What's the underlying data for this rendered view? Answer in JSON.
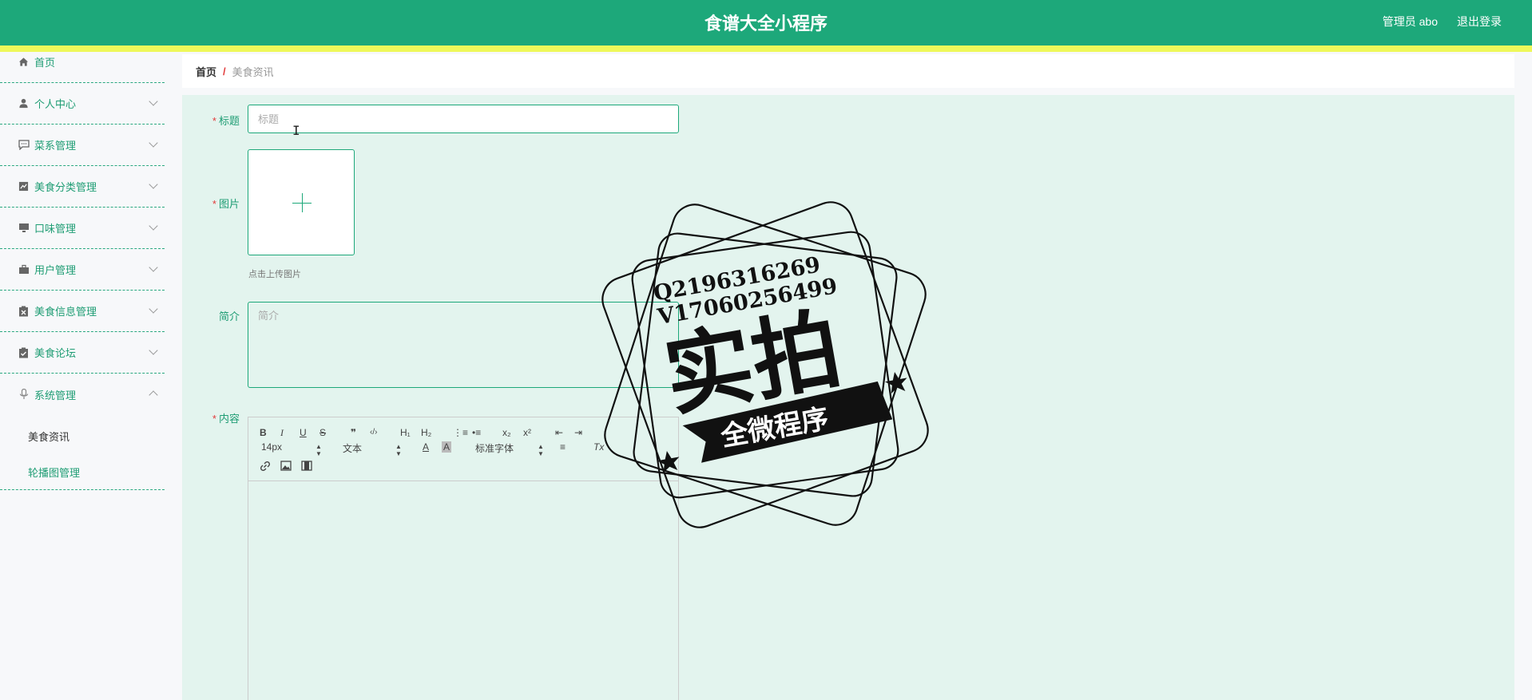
{
  "header": {
    "app_title": "食谱大全小程序",
    "user_label": "管理员 abo",
    "logout_label": "退出登录"
  },
  "sidebar": {
    "items": [
      {
        "label": "首页",
        "icon": "home-icon"
      },
      {
        "label": "个人中心",
        "icon": "user-icon"
      },
      {
        "label": "菜系管理",
        "icon": "chat-icon"
      },
      {
        "label": "美食分类管理",
        "icon": "chart-icon"
      },
      {
        "label": "口味管理",
        "icon": "monitor-icon"
      },
      {
        "label": "用户管理",
        "icon": "briefcase-icon"
      },
      {
        "label": "美食信息管理",
        "icon": "clipboard-x-icon"
      },
      {
        "label": "美食论坛",
        "icon": "clipboard-check-icon"
      },
      {
        "label": "系统管理",
        "icon": "microphone-icon"
      }
    ],
    "sub_items": [
      "美食资讯",
      "轮播图管理"
    ]
  },
  "breadcrumb": {
    "home": "首页",
    "separator": "/",
    "current": "美食资讯"
  },
  "form": {
    "title_label": "标题",
    "title_placeholder": "标题",
    "image_label": "图片",
    "upload_hint": "点击上传图片",
    "intro_label": "简介",
    "intro_placeholder": "简介",
    "content_label": "内容",
    "required_mark": "*"
  },
  "editor": {
    "font_size": "14px",
    "header_select": "文本",
    "font_family": "标准字体",
    "buttons": {
      "bold": "B",
      "italic": "I",
      "underline": "U",
      "strike": "S",
      "quote": "❞",
      "code": "‹/›",
      "h1": "H₁",
      "h2": "H₂",
      "ordered_list": "⋮≡",
      "bullet_list": "•≡",
      "subscript": "x₂",
      "superscript": "x²",
      "outdent": "⇤",
      "indent": "⇥",
      "color": "A",
      "background": "A",
      "align": "≡",
      "clean": "Tx"
    }
  },
  "watermark": {
    "line1": "Q2196316269",
    "line2": "V17060256499",
    "main": "实拍",
    "ribbon": "全微程序"
  },
  "colors": {
    "header_bg": "#1da87a",
    "stripe": "#eef85a",
    "accent": "#1f9d74",
    "main_bg": "#e3f4ee",
    "required": "#e23b3b"
  }
}
